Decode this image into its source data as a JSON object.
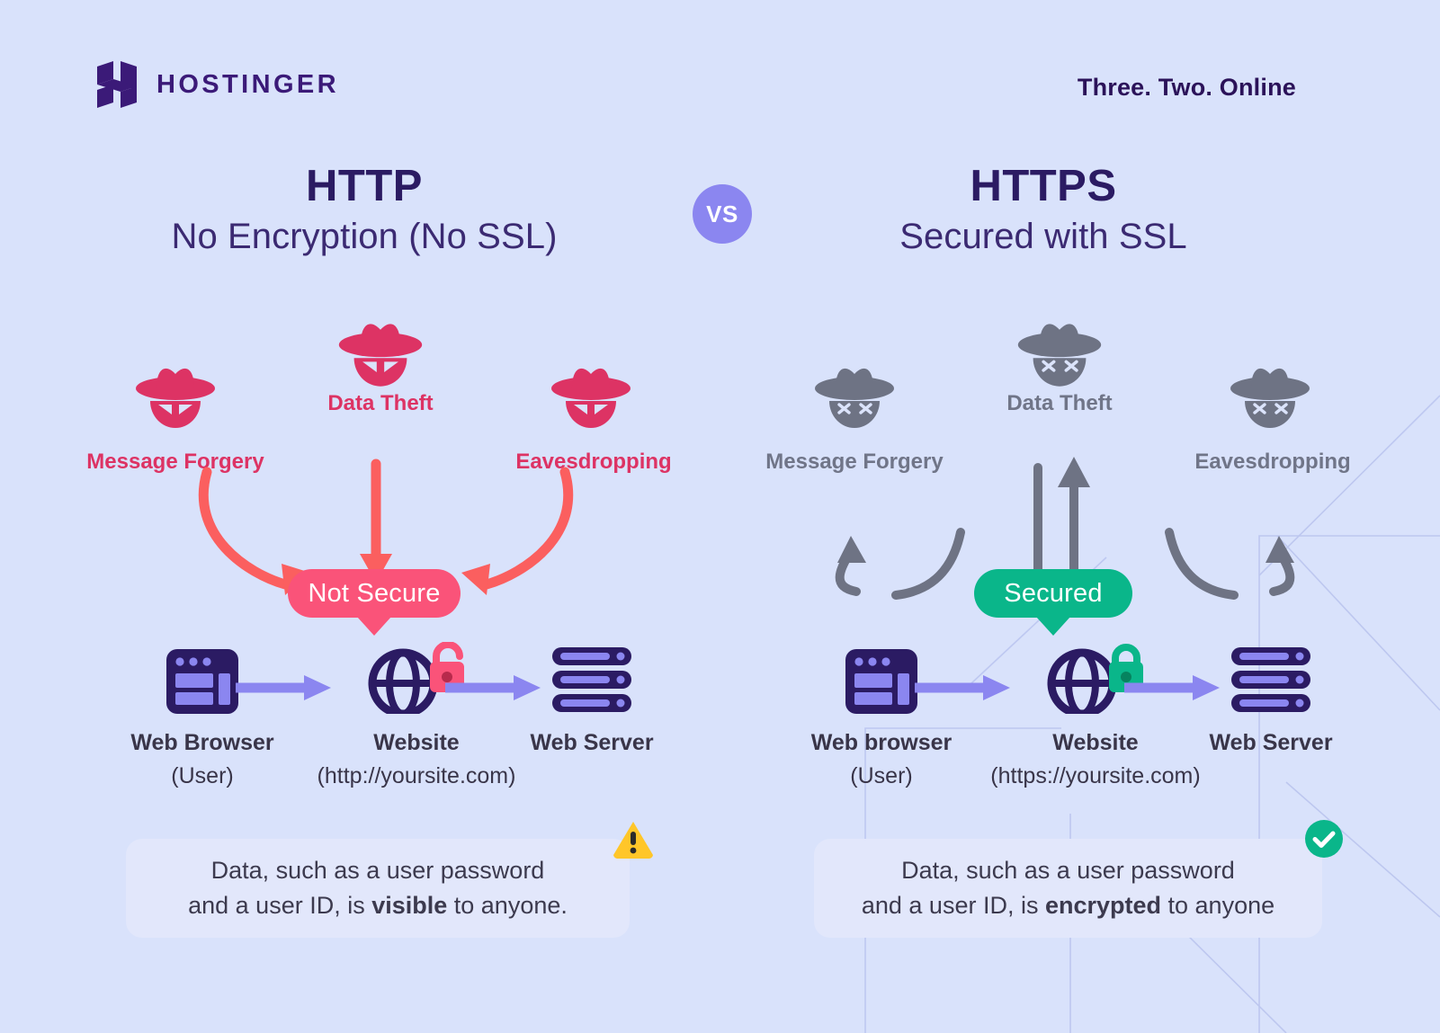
{
  "brand": {
    "logo_name": "HOSTINGER",
    "logo_icon": "hostinger-h-logo",
    "tagline": "Three. Two. Online"
  },
  "vs": {
    "label": "VS"
  },
  "columns": [
    {
      "id": "http",
      "protocol": "HTTP",
      "subtitle": "No Encryption (No SSL)",
      "status_badge": "Not Secure",
      "status_color": "#fa5379",
      "threat_color": "#dd3364",
      "arrow_color": "#fb5f5f",
      "spy_state": "active",
      "lock_icon": "unlocked-padlock-icon",
      "lock_color": "#fa5379",
      "threats": [
        {
          "label": "Message Forgery"
        },
        {
          "label": "Data Theft"
        },
        {
          "label": "Eavesdropping"
        }
      ],
      "nodes": [
        {
          "name": "Web Browser",
          "meta": "(User)",
          "icon": "browser-window-icon"
        },
        {
          "name": "Website",
          "meta": "(http://yoursite.com)",
          "icon": "globe-icon"
        },
        {
          "name": "Web Server",
          "meta": "",
          "icon": "server-stack-icon"
        }
      ],
      "callout": {
        "line1": "Data, such as a user password",
        "line2_before": "and a user ID, is ",
        "line2_strong": "visible",
        "line2_after": " to anyone.",
        "badge_icon": "warning-triangle-icon",
        "badge_color": "#ffc629"
      }
    },
    {
      "id": "https",
      "protocol": "HTTPS",
      "subtitle": "Secured with SSL",
      "status_badge": "Secured",
      "status_color": "#0ab68a",
      "threat_color": "#707588",
      "arrow_color": "#6e7384",
      "spy_state": "blocked",
      "lock_icon": "locked-padlock-icon",
      "lock_color": "#0ab68a",
      "threats": [
        {
          "label": "Message Forgery"
        },
        {
          "label": "Data Theft"
        },
        {
          "label": "Eavesdropping"
        }
      ],
      "nodes": [
        {
          "name": "Web browser",
          "meta": "(User)",
          "icon": "browser-window-icon"
        },
        {
          "name": "Website",
          "meta": "(https://yoursite.com)",
          "icon": "globe-icon"
        },
        {
          "name": "Web Server",
          "meta": "",
          "icon": "server-stack-icon"
        }
      ],
      "callout": {
        "line1": "Data, such as a user password",
        "line2_before": "and a user ID, is ",
        "line2_strong": "encrypted",
        "line2_after": " to anyone",
        "badge_icon": "check-circle-icon",
        "badge_color": "#0ab68a"
      }
    }
  ],
  "palette": {
    "background": "#d9e2fb",
    "deep_purple": "#2b1b63",
    "lavender": "#8b86f0",
    "callout_bg": "#e2e7fb"
  }
}
